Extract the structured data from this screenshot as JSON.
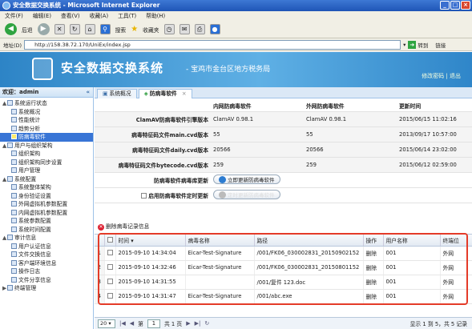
{
  "window": {
    "title": "安全数据交换系统 - Microsoft Internet Explorer",
    "controls": [
      "_",
      "□",
      "×"
    ]
  },
  "menu": [
    "文件(F)",
    "编辑(E)",
    "查看(V)",
    "收藏(A)",
    "工具(T)",
    "帮助(H)"
  ],
  "toolbar": {
    "back": "后退",
    "search": "搜索",
    "favorites": "收藏夹"
  },
  "address": {
    "label": "地址(D)",
    "url": "http://158.38.72.170/UniEx/index.jsp",
    "go": "转到",
    "links": "链接"
  },
  "banner": {
    "title": "安全数据交换系统",
    "subtitle": "- 宝鸡市金台区地方税务局",
    "links": "修改密码 | 退出"
  },
  "sidebar": {
    "welcome": "欢迎：admin",
    "collapse": "«",
    "items": [
      {
        "label": "系统运行状态",
        "level": 1,
        "toggle": "▲"
      },
      {
        "label": "系统概况",
        "level": 2
      },
      {
        "label": "性能统计",
        "level": 2
      },
      {
        "label": "趋势分析",
        "level": 2
      },
      {
        "label": "防病毒软件",
        "level": 2,
        "selected": true
      },
      {
        "label": "用户与组织架构",
        "level": 1,
        "toggle": "▲"
      },
      {
        "label": "组织架构",
        "level": 2
      },
      {
        "label": "组织架构同步设置",
        "level": 2
      },
      {
        "label": "用户管理",
        "level": 2
      },
      {
        "label": "系统配置",
        "level": 1,
        "toggle": "▲"
      },
      {
        "label": "系统整体架构",
        "level": 2
      },
      {
        "label": "身份验证设置",
        "level": 2
      },
      {
        "label": "外网虚拟机参数配置",
        "level": 2
      },
      {
        "label": "内网虚拟机参数配置",
        "level": 2
      },
      {
        "label": "系统参数配置",
        "level": 2
      },
      {
        "label": "系统时间配置",
        "level": 2
      },
      {
        "label": "审计信息",
        "level": 1,
        "toggle": "▲"
      },
      {
        "label": "用户认证信息",
        "level": 2
      },
      {
        "label": "文件交换信息",
        "level": 2
      },
      {
        "label": "客户端环境信息",
        "level": 2
      },
      {
        "label": "操作日志",
        "level": 2
      },
      {
        "label": "文件分享信息",
        "level": 2
      },
      {
        "label": "终端管理",
        "level": 1,
        "toggle": "▶"
      }
    ]
  },
  "tabs": [
    {
      "label": "系统概况",
      "active": false
    },
    {
      "label": "防病毒软件",
      "active": true,
      "close": "×"
    }
  ],
  "antivirus": {
    "headers": {
      "inner": "内网防病毒软件",
      "outer": "外网防病毒软件",
      "updated": "更新时间"
    },
    "rows": [
      {
        "label": "ClamAV防病毒软件引擎版本",
        "inner": "ClamAV 0.98.1",
        "outer": "ClamAV 0.98.1",
        "time": "2015/06/15 11:02:16"
      },
      {
        "label": "病毒特征码文件main.cvd版本",
        "inner": "55",
        "outer": "55",
        "time": "2013/09/17 10:57:00"
      },
      {
        "label": "病毒特征码文件daily.cvd版本",
        "inner": "20566",
        "outer": "20566",
        "time": "2015/06/14 23:02:00"
      },
      {
        "label": "病毒特征码文件bytecode.cvd版本",
        "inner": "259",
        "outer": "259",
        "time": "2015/06/12 02:59:00"
      }
    ],
    "update_label": "防病毒软件病毒库更新",
    "update_button": "立即更新防病毒软件",
    "schedule_label": "启用防病毒软件定时更新",
    "schedule_button": "定时更新防病毒软件"
  },
  "virus_log": {
    "delete_label": "删除病毒记录信息",
    "columns": [
      "",
      "",
      "时间 ▾",
      "病毒名称",
      "路径",
      "操作",
      "用户名称",
      "终端位"
    ],
    "rows": [
      {
        "num": "1",
        "time": "2015-09-10 14:34:04",
        "virus": "Eicar-Test-Signature",
        "path": "/001/FK06_030002831_20150902152",
        "action": "删除",
        "user": "001",
        "term": "外网"
      },
      {
        "num": "2",
        "time": "2015-09-10 14:32:46",
        "virus": "Eicar-Test-Signature",
        "path": "/001/FK06_030002831_20150801152",
        "action": "删除",
        "user": "001",
        "term": "外网"
      },
      {
        "num": "3",
        "time": "2015-09-10 14:31:55",
        "virus": "",
        "path": "/001/复件 123.doc",
        "action": "删除",
        "user": "001",
        "term": "外网"
      },
      {
        "num": "4",
        "time": "2015-09-10 14:31:47",
        "virus": "Eicar-Test-Signature",
        "path": "/001/abc.exe",
        "action": "删除",
        "user": "001",
        "term": "外网"
      }
    ]
  },
  "pager": {
    "page_size": "20",
    "page_prefix": "第",
    "page": "1",
    "page_suffix": "共 1 页",
    "summary": "显示 1 到 5，共 5 记录"
  },
  "colors": {
    "banner": "#2d84c6",
    "selected": "#3875d6",
    "highlight_box": "#e43b28"
  }
}
